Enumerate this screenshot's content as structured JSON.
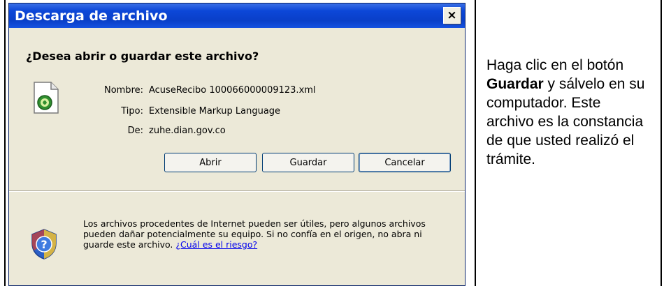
{
  "dialog": {
    "title": "Descarga de archivo",
    "close_glyph": "×",
    "question": "¿Desea abrir o guardar este archivo?",
    "file_icon": "xml-file-icon",
    "fields": [
      {
        "label": "Nombre:",
        "value": "AcuseRecibo 100066000009123.xml"
      },
      {
        "label": "Tipo:",
        "value": "Extensible Markup Language"
      },
      {
        "label": "De:",
        "value": "zuhe.dian.gov.co"
      }
    ],
    "buttons": {
      "open": "Abrir",
      "save": "Guardar",
      "cancel": "Cancelar"
    },
    "warning": {
      "icon": "shield-question-icon",
      "text": "Los archivos procedentes de Internet pueden ser útiles, pero algunos archivos pueden dañar potencialmente su equipo. Si no confía en el origen, no abra ni guarde este archivo.",
      "link": "¿Cuál es el riesgo?"
    }
  },
  "instruction": {
    "before": "Haga clic en el botón ",
    "bold": "Guardar",
    "after": " y sálvelo en su computador. Este archivo es la constancia de que usted realizó el trámite."
  },
  "colors": {
    "titlebar": "#0a3fc8",
    "dialog_bg": "#ece9d8",
    "link": "#0000ee"
  }
}
